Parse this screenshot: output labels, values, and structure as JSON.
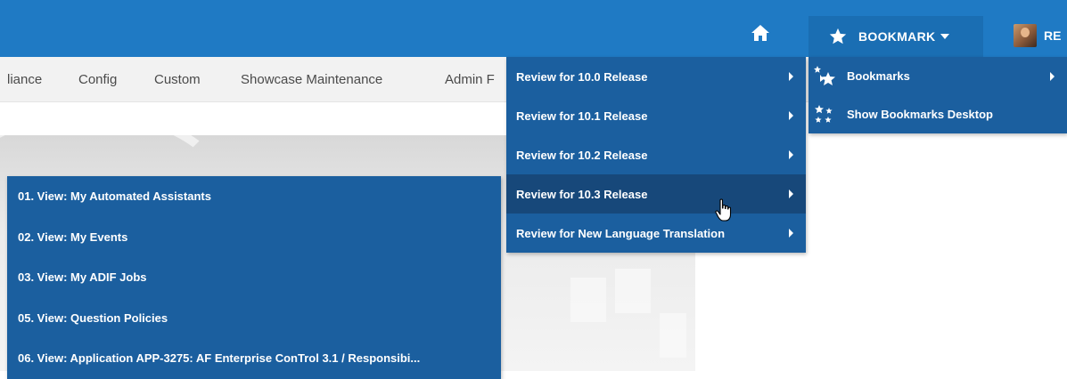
{
  "header": {
    "bookmark_label": "BOOKMARK",
    "user_label": "RE"
  },
  "nav": {
    "items": [
      "liance",
      "Config",
      "Custom",
      "Showcase Maintenance",
      "Admin F"
    ]
  },
  "views_menu": {
    "items": [
      "01. View: My Automated Assistants",
      "02. View: My Events",
      "03. View: My ADIF Jobs",
      "05. View: Question Policies",
      "06. View: Application APP-3275: AF Enterprise ConTrol 3.1 / Responsibi..."
    ]
  },
  "release_menu": {
    "items": [
      "Review for 10.0 Release",
      "Review for 10.1 Release",
      "Review for 10.2 Release",
      "Review for 10.3 Release",
      "Review for New Language Translation"
    ],
    "active_index": 3
  },
  "bookmark_menu": {
    "items": [
      {
        "label": "Bookmarks",
        "icon": "bookmarks-stars-icon"
      },
      {
        "label": "Show Bookmarks Desktop",
        "icon": "desktop-stars-icon"
      }
    ]
  },
  "colors": {
    "topbar": "#1f7ac4",
    "menu": "#1b5f9f",
    "menu_active": "#17487a",
    "nav_bg": "#f2f2f2"
  }
}
